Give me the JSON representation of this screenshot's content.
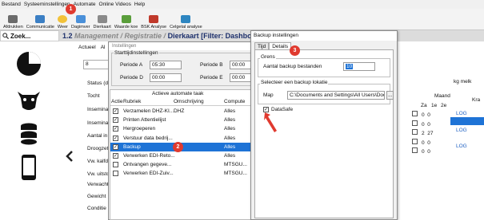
{
  "menubar": [
    "Bestand",
    "Systeeminstellingen",
    "Automate",
    "Online Videos",
    "Help"
  ],
  "toolbar": [
    "Afdrukken",
    "Communicatie",
    "Weer",
    "Dagimver",
    "Dierkaart",
    "Waarde koe",
    "BSK Analyse",
    "Celgetal analyse"
  ],
  "search": {
    "text": "Zoek..."
  },
  "title_bar": {
    "prefix": "1.2",
    "muted": "Management / Registratie /",
    "highlight": "Dierkaart [Filter: Dashbo"
  },
  "background": {
    "tabs": [
      "Actueel",
      "Al"
    ],
    "field_value": "8",
    "labels": [
      "Status (da",
      "Tocht",
      "Insemina",
      "Insemina",
      "Aantal in",
      "Droogzet",
      "Vw. kalfd",
      "Vw. uitstc",
      "Verwacht",
      "Gewicht",
      "Conditie"
    ],
    "right_headers": [
      "Za",
      "1e",
      "2e",
      "Maand",
      "Kra"
    ],
    "right_label": "kg melk",
    "right_values": [
      [
        "0",
        "0"
      ],
      [
        "0",
        "0"
      ],
      [
        "2",
        "27"
      ],
      [
        "0",
        "0"
      ],
      [
        "0",
        "0"
      ]
    ],
    "right_log": [
      "LOG",
      "LOG",
      "LOG"
    ]
  },
  "instellingen_dialog": {
    "title": "Instellingen",
    "group": "Starttijdinstellingen",
    "periodes": [
      {
        "label": "Periode A",
        "value": "05:30"
      },
      {
        "label": "Periode B",
        "value": "00:00"
      },
      {
        "label": "Periode D",
        "value": "00:00"
      },
      {
        "label": "Periode E",
        "value": "00:00"
      }
    ],
    "extra_fields": [
      "00:00",
      "00:00"
    ],
    "table": {
      "group_header": "Actieve automate taak",
      "columns": [
        "Actie",
        "Rubriek",
        "Omschrijving",
        "Compute"
      ],
      "rows": [
        {
          "rubriek": "Verzamelen DHZ-KI...",
          "omschrijving": "DHZ",
          "computer": "Alles",
          "checked": true
        },
        {
          "rubriek": "Printen Attentielijst",
          "omschrijving": "",
          "computer": "Alles",
          "checked": true
        },
        {
          "rubriek": "Hergroeperen",
          "omschrijving": "",
          "computer": "Alles",
          "checked": true
        },
        {
          "rubriek": "Verstuur data bedrij...",
          "omschrijving": "",
          "computer": "Alles",
          "checked": true
        },
        {
          "rubriek": "Backup",
          "omschrijving": "",
          "computer": "Alles",
          "checked": true,
          "selected": true
        },
        {
          "rubriek": "Verwerken EDI-Reto...",
          "omschrijving": "",
          "computer": "Alles",
          "checked": true
        },
        {
          "rubriek": "Ontvangen gegeve...",
          "omschrijving": "",
          "computer": "MTSGU...",
          "checked": false
        },
        {
          "rubriek": "Verwerken EDI-Zuiv...",
          "omschrijving": "",
          "computer": "MTSGU...",
          "checked": false
        }
      ]
    }
  },
  "backup_dialog": {
    "title": "Backup instellingen",
    "tabs": [
      "Tijd",
      "Details"
    ],
    "active_tab": "Details",
    "grens_group": "Grens",
    "aantal_label": "Aantal backup bestanden",
    "aantal_value": "10",
    "locatie_group": "Selecteer een backup lokatie",
    "map_label": "Map",
    "map_value": "C:\\Documents and Settings\\All Users\\Docu",
    "browse_label": "...",
    "datasafe_label": "DataSafe",
    "datasafe_checked": true
  },
  "annotations": [
    "1",
    "2",
    "3"
  ],
  "colors": {
    "selection": "#1e73d6",
    "badge": "#e03a2f",
    "title_highlight": "#1c2f6b"
  }
}
